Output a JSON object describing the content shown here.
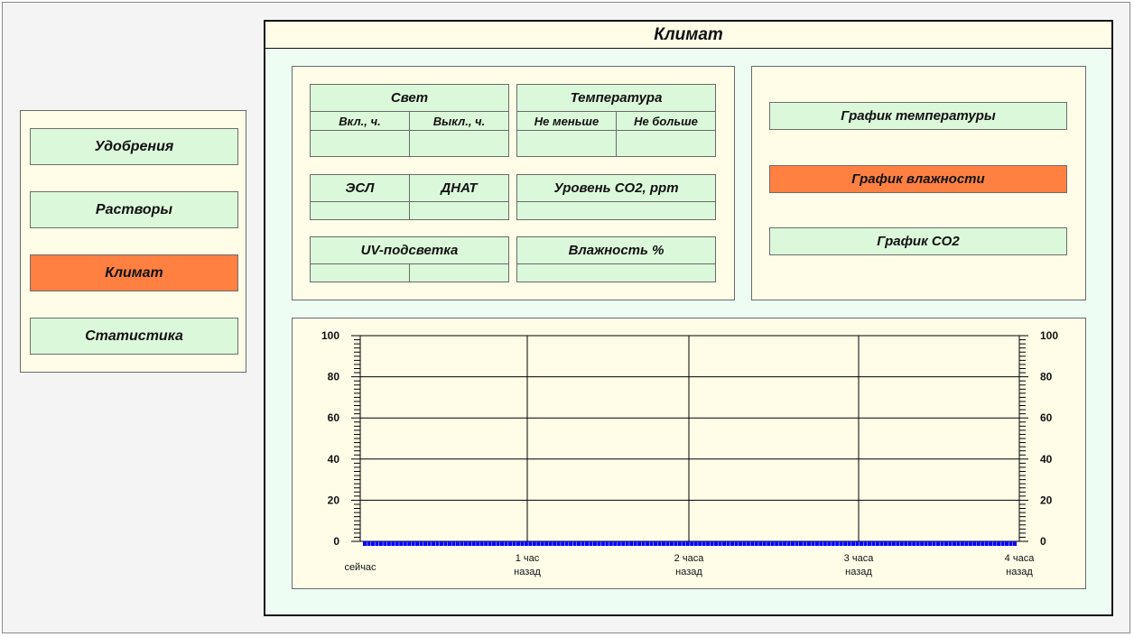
{
  "sidebar": {
    "items": [
      {
        "label": "Удобрения",
        "active": false
      },
      {
        "label": "Растворы",
        "active": false
      },
      {
        "label": "Климат",
        "active": true
      },
      {
        "label": "Статистика",
        "active": false
      }
    ]
  },
  "main": {
    "title": "Климат",
    "settings": {
      "light": {
        "title": "Свет",
        "on_label": "Вкл., ч.",
        "off_label": "Выкл., ч.",
        "on_value": "",
        "off_value": ""
      },
      "temperature": {
        "title": "Температура",
        "min_label": "Не меньше",
        "max_label": "Не больше",
        "min_value": "",
        "max_value": ""
      },
      "esl": {
        "label": "ЭСЛ",
        "value": ""
      },
      "dnat": {
        "label": "ДНАТ",
        "value": ""
      },
      "co2": {
        "label": "Уровень CO2, ppm",
        "value": ""
      },
      "uv": {
        "label": "UV-подсветка",
        "value1": "",
        "value2": ""
      },
      "humidity": {
        "label": "Влажность %",
        "value": ""
      }
    },
    "graph_buttons": [
      {
        "label": "График температуры",
        "active": false
      },
      {
        "label": "График влажности",
        "active": true
      },
      {
        "label": "График CO2",
        "active": false
      }
    ]
  },
  "colors": {
    "active": "#ff8040",
    "button": "#dcf8da",
    "panel": "#fffde8",
    "series": "#0000ff"
  },
  "chart_data": {
    "type": "line",
    "ylim": [
      0,
      100
    ],
    "y_ticks": [
      "0",
      "20",
      "40",
      "60",
      "80",
      "100"
    ],
    "x_ticks": [
      {
        "line1": "сейчас",
        "line2": ""
      },
      {
        "line1": "1 час",
        "line2": "назад"
      },
      {
        "line1": "2 часа",
        "line2": "назад"
      },
      {
        "line1": "3 часа",
        "line2": "назад"
      },
      {
        "line1": "4 часа",
        "line2": "назад"
      }
    ],
    "grid": true,
    "series": [
      {
        "color": "#0000ff",
        "values": [
          0,
          0,
          0,
          0,
          0,
          0,
          0,
          0,
          0,
          0,
          0,
          0,
          0,
          0,
          0,
          0,
          0,
          0,
          0,
          0,
          0,
          0,
          0,
          0,
          0,
          0,
          0,
          0,
          0,
          0,
          0,
          0,
          0,
          0,
          0,
          0,
          0,
          0,
          0,
          0,
          0,
          0,
          0,
          0,
          0,
          0,
          0,
          0,
          0,
          0,
          0,
          0,
          0,
          0,
          0,
          0,
          0,
          0,
          0,
          0,
          0,
          0,
          0,
          0,
          0,
          0,
          0,
          0,
          0,
          0,
          0,
          0,
          0,
          0,
          0,
          0,
          0,
          0,
          0,
          0,
          0,
          0,
          0,
          0,
          0,
          0,
          0,
          0,
          0,
          0,
          0,
          0,
          0,
          0,
          0,
          0,
          0,
          0,
          0,
          0,
          0,
          0,
          0,
          0,
          0,
          0,
          0,
          0,
          0,
          0,
          0,
          0,
          0,
          0,
          0,
          0,
          0,
          0,
          0,
          0,
          0,
          0,
          0,
          0,
          0,
          0,
          0,
          0,
          0,
          0,
          0,
          0,
          0,
          0,
          0,
          0,
          0,
          0,
          0,
          0,
          0,
          0,
          0,
          0,
          0,
          0,
          0,
          0,
          0,
          0,
          0,
          0,
          0,
          0,
          0,
          0,
          0,
          0,
          0,
          0,
          0,
          0
        ]
      }
    ]
  }
}
